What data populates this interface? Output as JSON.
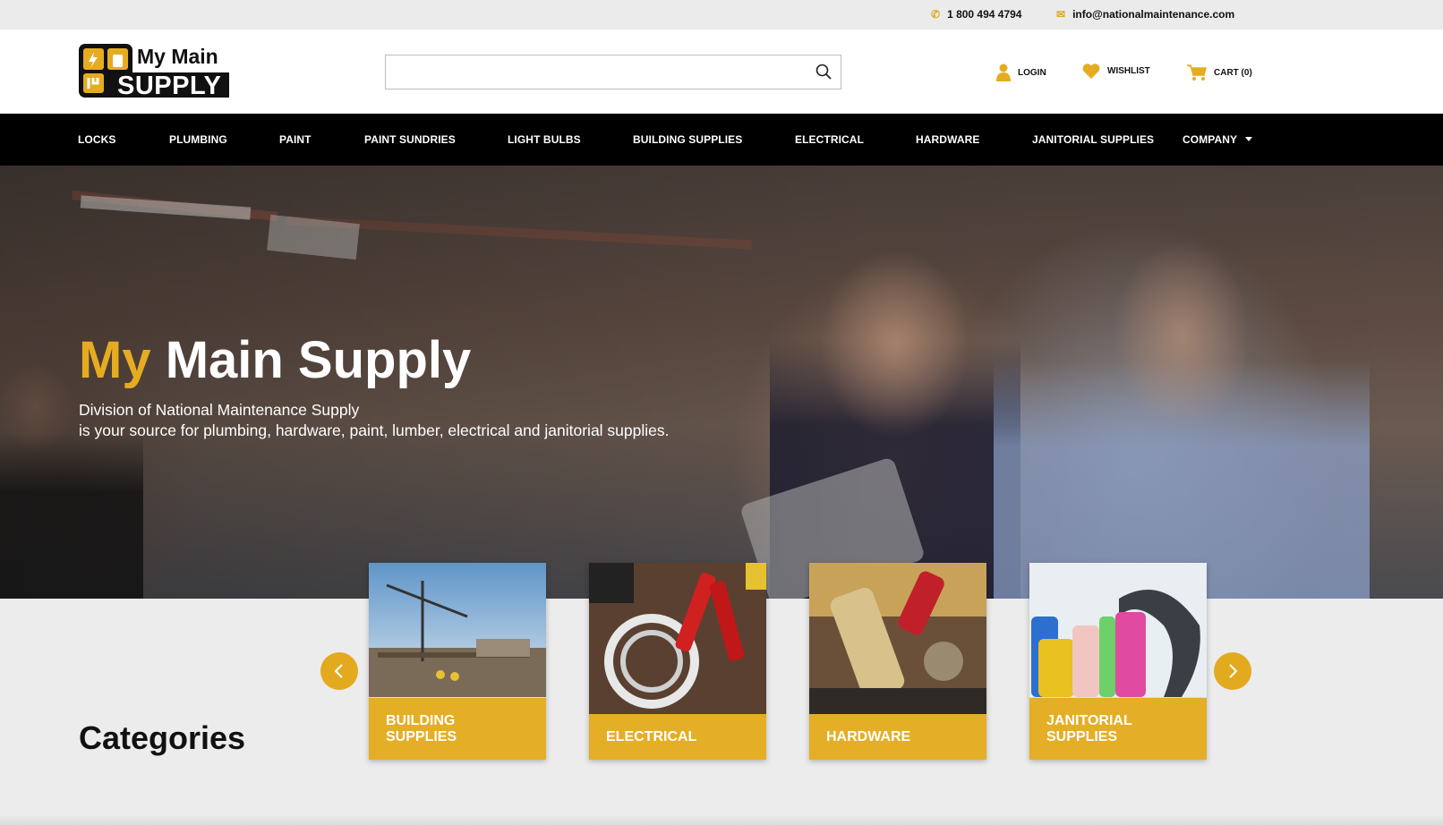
{
  "topbar": {
    "phone": "1 800 494 4794",
    "email": "info@nationalmaintenance.com"
  },
  "logo": {
    "line1": "My Main",
    "line2": "SUPPLY"
  },
  "search": {
    "placeholder": ""
  },
  "header_links": {
    "login": "LOGIN",
    "wishlist": "WISHLIST",
    "cart": "CART (0)"
  },
  "nav": {
    "items": [
      "LOCKS",
      "PLUMBING",
      "PAINT",
      "PAINT SUNDRIES",
      "LIGHT BULBS",
      "BUILDING SUPPLIES",
      "ELECTRICAL",
      "HARDWARE",
      "JANITORIAL SUPPLIES",
      "COMPANY"
    ]
  },
  "hero": {
    "title_my": "My",
    "title_rest": "Main Supply",
    "subtitle_line1": "Division of National Maintenance Supply",
    "subtitle_line2": "is your source for plumbing, hardware, paint, lumber, electrical and janitorial supplies."
  },
  "categories": {
    "heading": "Categories",
    "cards": [
      {
        "line1": "BUILDING",
        "line2": "SUPPLIES"
      },
      {
        "line1": "ELECTRICAL",
        "line2": ""
      },
      {
        "line1": "HARDWARE",
        "line2": ""
      },
      {
        "line1": "JANITORIAL",
        "line2": "SUPPLIES"
      }
    ]
  },
  "colors": {
    "accent": "#e4ae26",
    "nav_bg": "#000000",
    "topbar_bg": "#ebebeb"
  }
}
